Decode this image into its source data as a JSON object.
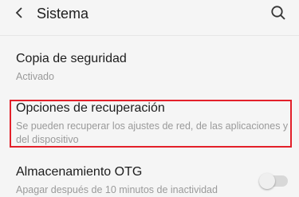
{
  "header": {
    "title": "Sistema",
    "back_icon": "chevron-left-icon",
    "search_icon": "search-icon"
  },
  "settings": [
    {
      "title": "Copia de seguridad",
      "subtitle": "Activado"
    },
    {
      "title": "Opciones de recuperación",
      "subtitle": "Se pueden recuperar los ajustes de red, de las aplicaciones y del dispositivo"
    },
    {
      "title": "Almacenamiento OTG",
      "subtitle": "Apagar después de 10 minutos de inactividad",
      "toggle_on": false
    }
  ],
  "colors": {
    "highlight": "#e3202a",
    "background": "#f5f5f5"
  }
}
